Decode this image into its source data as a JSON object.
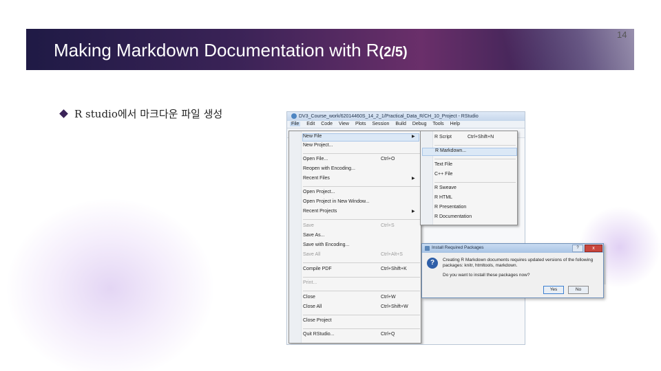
{
  "slide": {
    "title": "Making Markdown Documentation with R",
    "title_suffix": "(2/5)",
    "page_number": "14",
    "bullet": "R studio에서 마크다운 파일 생성",
    "colors": {
      "title_bar_start": "#1f1a45",
      "title_bar_mid": "#6a2f6a",
      "bullet": "#3a2358"
    }
  },
  "rstudio": {
    "window_title": "DV3_Course_work/62014460S_14_2_1/Practical_Data_R/CH_10_Project - RStudio",
    "menubar": [
      "File",
      "Edit",
      "Code",
      "View",
      "Plots",
      "Session",
      "Build",
      "Debug",
      "Tools",
      "Help"
    ],
    "file_menu": {
      "new_file": "New File",
      "new_project": "New Project...",
      "open_file": "Open File...",
      "open_file_sc": "Ctrl+O",
      "reopen": "Reopen with Encoding...",
      "recent_files": "Recent Files",
      "open_project": "Open Project...",
      "open_project_window": "Open Project in New Window...",
      "recent_projects": "Recent Projects",
      "save": "Save",
      "save_sc": "Ctrl+S",
      "save_as": "Save As...",
      "save_encoding": "Save with Encoding...",
      "save_all": "Save All",
      "save_all_sc": "Ctrl+Alt+S",
      "compile_pdf": "Compile PDF",
      "compile_pdf_sc": "Ctrl+Shift+K",
      "print": "Print...",
      "close": "Close",
      "close_sc": "Ctrl+W",
      "close_all": "Close All",
      "close_all_sc": "Ctrl+Shift+W",
      "close_project": "Close Project",
      "quit": "Quit RStudio...",
      "quit_sc": "Ctrl+Q",
      "submenu_arrow": "▶"
    },
    "new_file_submenu": {
      "r_script": "R Script",
      "r_script_sc": "Ctrl+Shift+N",
      "r_markdown": "R Markdown...",
      "text_file": "Text File",
      "cpp_file": "C++ File",
      "r_sweave": "R Sweave",
      "r_html": "R HTML",
      "r_presentation": "R Presentation",
      "r_documentation": "R Documentation"
    }
  },
  "dialog": {
    "title": "Install Required Packages",
    "help": "?",
    "close": "x",
    "icon": "?",
    "message": "Creating R Markdown documents requires updated versions of the following packages: knitr, htmltools, markdown.",
    "question": "Do you want to install these packages now?",
    "yes": "Yes",
    "no": "No"
  }
}
